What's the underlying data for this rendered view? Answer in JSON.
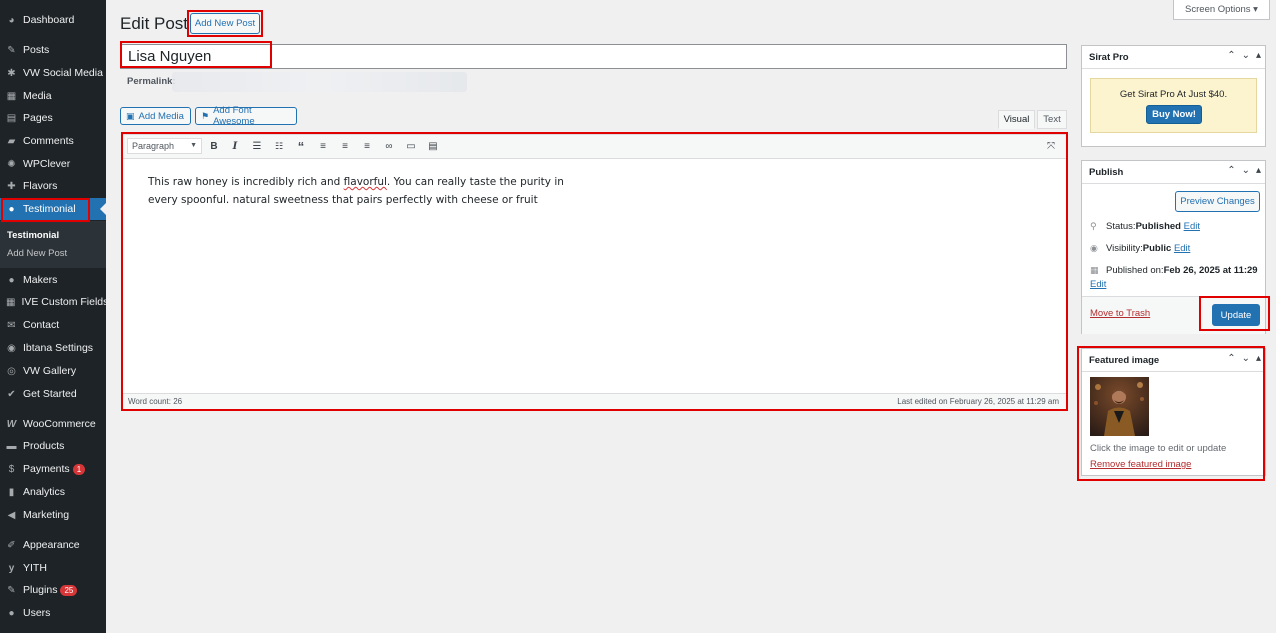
{
  "sidebar": {
    "items": [
      {
        "label": "Dashboard",
        "icon": "dashboard-icon"
      },
      {
        "label": "Posts",
        "icon": "pin-icon"
      },
      {
        "label": "VW Social Media",
        "icon": "gear-icon"
      },
      {
        "label": "Media",
        "icon": "media-icon"
      },
      {
        "label": "Pages",
        "icon": "page-icon"
      },
      {
        "label": "Comments",
        "icon": "comment-icon"
      },
      {
        "label": "WPClever",
        "icon": "sparkle-icon"
      },
      {
        "label": "Flavors",
        "icon": "flavor-icon"
      },
      {
        "label": "Testimonial",
        "icon": "user-icon"
      },
      {
        "label": "Makers",
        "icon": "users-icon"
      },
      {
        "label": "IVE Custom Fields",
        "icon": "fields-icon"
      },
      {
        "label": "Contact",
        "icon": "mail-icon"
      },
      {
        "label": "Ibtana Settings",
        "icon": "settings-icon"
      },
      {
        "label": "VW Gallery",
        "icon": "gallery-icon"
      },
      {
        "label": "Get Started",
        "icon": "check-icon"
      },
      {
        "label": "WooCommerce",
        "icon": "woo-icon"
      },
      {
        "label": "Products",
        "icon": "archive-icon"
      },
      {
        "label": "Payments",
        "icon": "dollar-icon",
        "badge": "1"
      },
      {
        "label": "Analytics",
        "icon": "chart-icon"
      },
      {
        "label": "Marketing",
        "icon": "megaphone-icon"
      },
      {
        "label": "Appearance",
        "icon": "brush-icon"
      },
      {
        "label": "YITH",
        "icon": "yith-icon"
      },
      {
        "label": "Plugins",
        "icon": "plugin-icon",
        "badge": "25"
      },
      {
        "label": "Users",
        "icon": "user-icon"
      }
    ],
    "submenu": [
      "Testimonial",
      "Add New Post"
    ]
  },
  "header": {
    "title": "Edit Post",
    "add_new": "Add New Post",
    "screen_options": "Screen Options ▾"
  },
  "post": {
    "title": "Lisa Nguyen",
    "permalink_label": "Permalink:",
    "body_line1_a": "This raw honey is incredibly rich and ",
    "body_line1_b": "flavorful",
    "body_line1_c": ". You can really taste the purity in",
    "body_line2": "every spoonful. natural sweetness that pairs perfectly with cheese or fruit"
  },
  "editor": {
    "add_media": "Add Media",
    "add_font": "Add Font Awesome",
    "tab_visual": "Visual",
    "tab_text": "Text",
    "format": "Paragraph",
    "word_count": "Word count: 26",
    "last_edited": "Last edited on February 26, 2025 at 11:29 am"
  },
  "sirat": {
    "title": "Sirat Pro",
    "promo": "Get Sirat Pro At Just $40.",
    "button": "Buy Now!"
  },
  "publish": {
    "title": "Publish",
    "preview": "Preview Changes",
    "status_label": "Status: ",
    "status_value": "Published",
    "visibility_label": "Visibility: ",
    "visibility_value": "Public",
    "published_label": "Published on: ",
    "published_value": "Feb 26, 2025 at 11:29",
    "edit": "Edit",
    "trash": "Move to Trash",
    "update": "Update"
  },
  "featured": {
    "title": "Featured image",
    "hint": "Click the image to edit or update",
    "remove": "Remove featured image"
  },
  "colors": {
    "sidebar_bg": "#1d2327",
    "accent": "#2271b1",
    "highlight": "#e00000"
  }
}
